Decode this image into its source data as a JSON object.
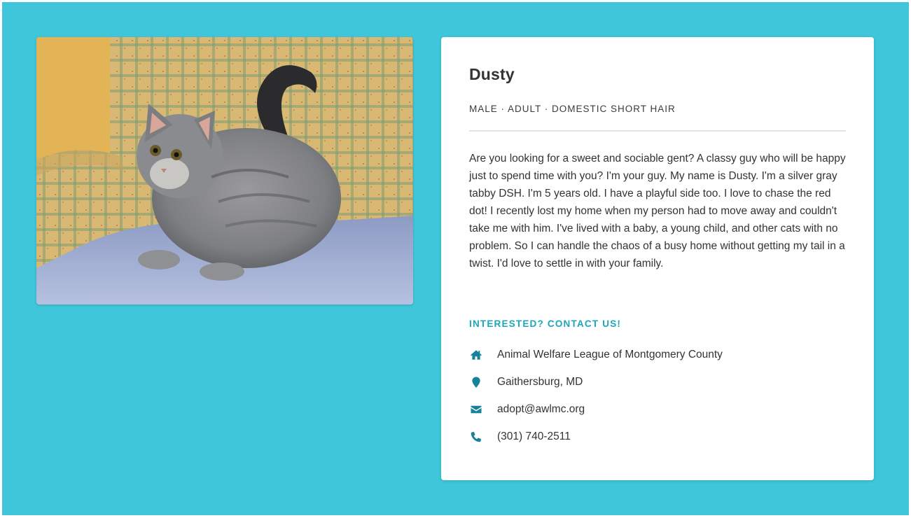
{
  "pet": {
    "name": "Dusty",
    "meta": "MALE · ADULT · DOMESTIC SHORT HAIR",
    "photo_subject": "gray tabby cat sitting on a plaid armchair",
    "description": "Are you looking for a sweet and sociable gent? A classy guy who will be happy just to spend time with you? I'm your guy. My name is Dusty. I'm a silver gray tabby DSH. I'm 5 years old. I have a playful side too. I love to chase the red dot! I recently lost my home when my person had to move away and couldn't take me with him. I've lived with a baby, a young child, and other cats with no problem. So I can handle the chaos of a busy home without getting my tail in a twist. I'd love to settle in with your family."
  },
  "contact": {
    "heading": "INTERESTED? CONTACT US!",
    "items": [
      {
        "icon": "home-icon",
        "text": "Animal Welfare League of Montgomery County"
      },
      {
        "icon": "map-pin-icon",
        "text": "Gaithersburg, MD"
      },
      {
        "icon": "envelope-icon",
        "text": "adopt@awlmc.org"
      },
      {
        "icon": "phone-icon",
        "text": "(301) 740-2511"
      }
    ]
  },
  "colors": {
    "background": "#3fc6da",
    "accent": "#1ba6ba",
    "icon": "#17839a",
    "card": "#ffffff",
    "text": "#333333"
  }
}
